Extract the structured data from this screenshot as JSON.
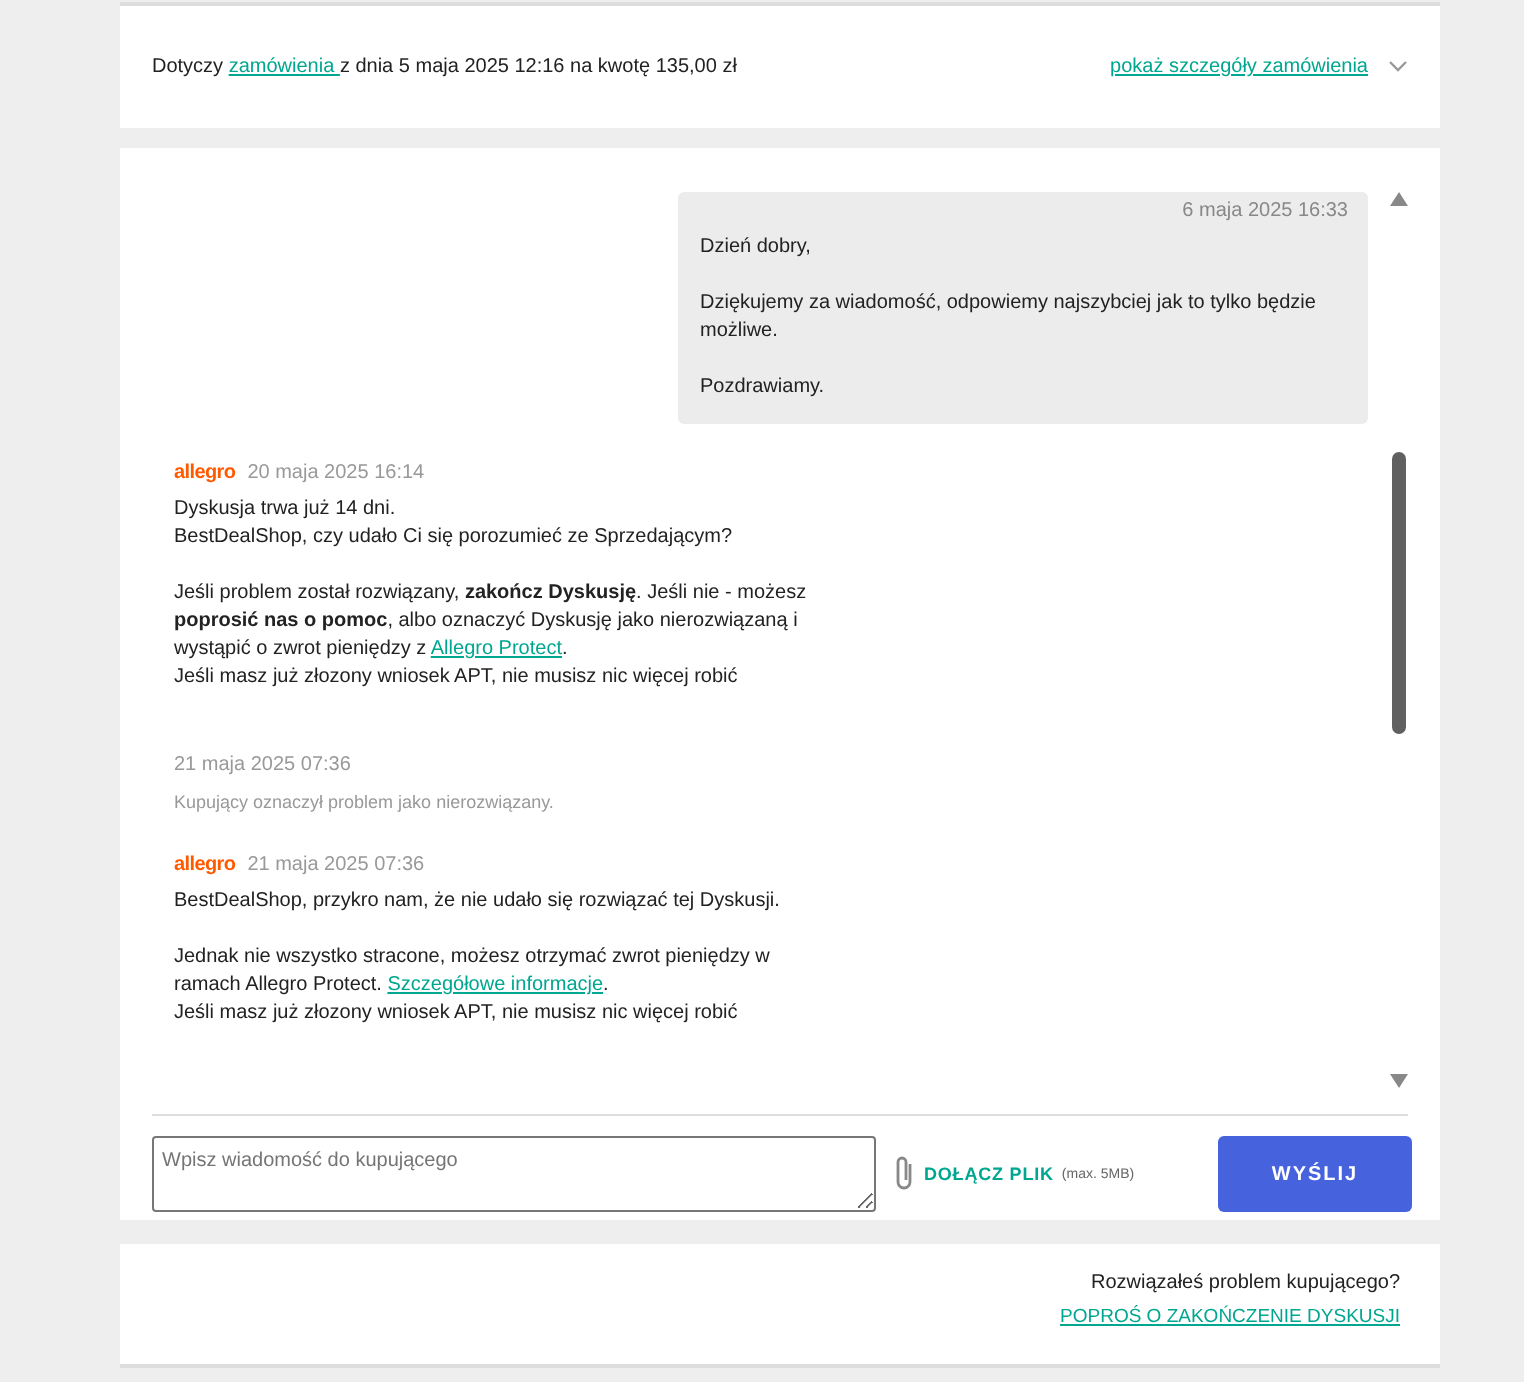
{
  "order_bar": {
    "parts": [
      "Dotyczy ",
      {
        "link": "zamówienia "
      },
      "z dnia 5 maja 2025 12:16 na kwotę 135,00 zł"
    ],
    "details_link": "pokaż szczegóły zamówienia",
    "expanded": false
  },
  "messages": [
    {
      "kind": "own",
      "date": "6 maja 2025 16:33",
      "paragraphs": [
        [
          [
            "Dzień dobry,"
          ]
        ],
        [
          [
            "Dziękujemy za wiadomość, odpowiemy najszybciej jak to tylko będzie możliwe."
          ]
        ],
        [
          [
            "Pozdrawiamy."
          ]
        ]
      ]
    },
    {
      "kind": "system",
      "sender": "allegro",
      "date": "20 maja 2025 16:14",
      "paragraphs": [
        [
          [
            "Dyskusja trwa już 14 dni."
          ],
          [
            "BestDealShop, czy udało Ci się porozumieć ze Sprzedającym?"
          ]
        ],
        [
          [
            "Jeśli problem został rozwiązany, **zakończ Dyskusję**. Jeśli nie - możesz **poprosić nas o pomoc**, albo oznaczyć Dyskusję jako nierozwiązaną i wystąpić o zwrot pieniędzy z ",
            {
              "link": "Allegro Protect"
            },
            "."
          ],
          [
            "Jeśli masz już złozony wniosek APT, nie musisz nic więcej robić"
          ]
        ]
      ]
    },
    {
      "kind": "event",
      "date": "21 maja 2025 07:36",
      "paragraphs": [
        [
          [
            "Kupujący oznaczył problem jako nierozwiązany."
          ]
        ]
      ]
    },
    {
      "kind": "system",
      "sender": "allegro",
      "date": "21 maja 2025 07:36",
      "paragraphs": [
        [
          [
            "BestDealShop, przykro nam, że nie udało się rozwiązać tej Dyskusji."
          ]
        ],
        [
          [
            "Jednak nie wszystko stracone, możesz otrzymać zwrot pieniędzy w ramach Allegro Protect. ",
            {
              "link": "Szczegółowe informacje"
            },
            "."
          ],
          [
            "Jeśli masz już złozony wniosek APT, nie musisz nic więcej robić"
          ]
        ]
      ]
    }
  ],
  "composer": {
    "placeholder": "Wpisz wiadomość do kupującego",
    "attach_label": "DOŁĄCZ PLIK",
    "attach_hint": "(max. 5MB)",
    "send_button": "WYŚLIJ"
  },
  "resolve": {
    "question": "Rozwiązałeś problem kupującego?",
    "link": "POPROŚ O ZAKOŃCZENIE DYSKUSJI"
  }
}
